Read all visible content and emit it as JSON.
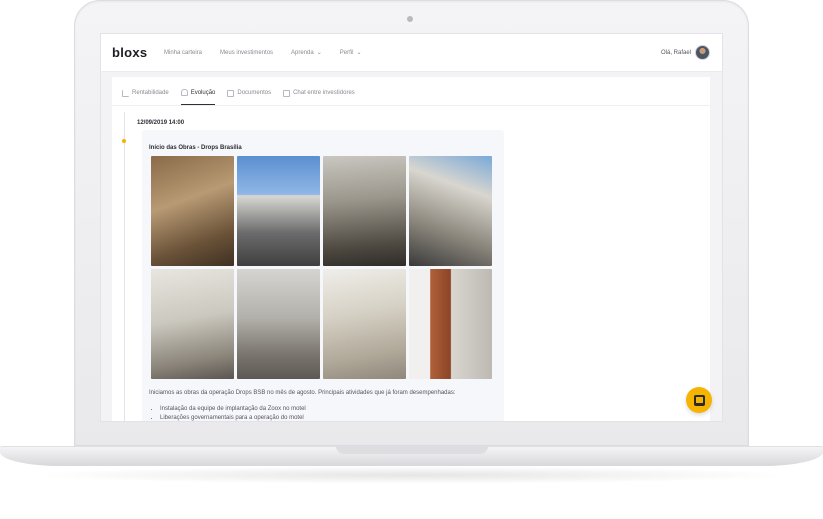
{
  "app": {
    "logo_text": "bloxs",
    "nav": [
      {
        "label": "Minha carteira"
      },
      {
        "label": "Meus investimentos"
      },
      {
        "label": "Aprenda",
        "has_dropdown": true
      },
      {
        "label": "Perfil",
        "has_dropdown": true
      }
    ],
    "user_greeting": "Olá, Rafael"
  },
  "tabs": [
    {
      "label": "Rentabilidade",
      "icon": "chart-icon"
    },
    {
      "label": "Evolução",
      "icon": "bell-icon",
      "active": true
    },
    {
      "label": "Documentos",
      "icon": "document-icon"
    },
    {
      "label": "Chat entre investidores",
      "icon": "chat-icon"
    }
  ],
  "timeline": {
    "date": "12/09/2019 14:00",
    "post": {
      "title": "Início das Obras - Drops Brasília",
      "photo_count": 8,
      "body": "Iniciamos as obras da operação Drops BSB no mês de agosto. Principais atividades que já foram desempenhadas:",
      "bullets": [
        "Instalação da equipe de implantação da Zoox no motel",
        "Liberações governamentais para a operação do motel"
      ]
    }
  },
  "colors": {
    "accent": "#f5b400",
    "text_primary": "#2c2c34",
    "text_muted": "#8a8a93"
  },
  "chat_button_icon": "chat-bubble-icon"
}
